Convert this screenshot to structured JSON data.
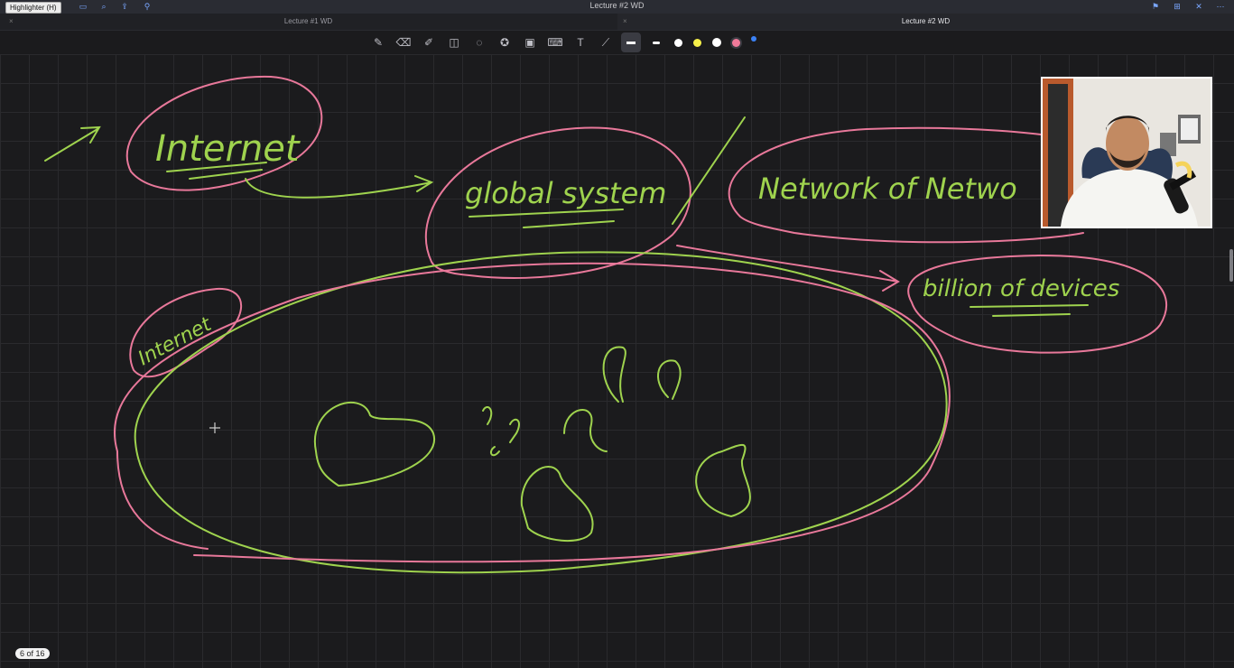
{
  "window": {
    "title": "Lecture #2 WD",
    "tooltip": "Highlighter (H)"
  },
  "tabs": [
    {
      "label": "Lecture #1 WD"
    },
    {
      "label": "Lecture #2 WD"
    }
  ],
  "toolbar": {
    "tools": [
      "pen-icon",
      "eraser-icon",
      "highlighter-icon",
      "shapes-icon",
      "lasso-icon",
      "sticker-icon",
      "image-icon",
      "keyboard-icon",
      "text-icon",
      "laser-pointer-icon"
    ],
    "thickness": [
      "thick",
      "thin"
    ],
    "colors": [
      "#ffffff",
      "#f6f04a",
      "#ffffff",
      "#f07a9a",
      "#3b82f6"
    ]
  },
  "ink": {
    "green_color": "#9fd34e",
    "pink_color": "#e8789a",
    "internet_title": "Internet",
    "global_system": "global system",
    "network_of_networks": "Network of Netwo",
    "billions_of_devices": "billion of devices",
    "internet_small": "Internet"
  },
  "page": {
    "indicator": "6 of 16"
  }
}
